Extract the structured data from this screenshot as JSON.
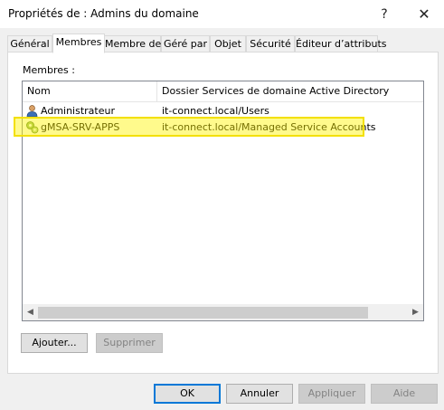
{
  "window": {
    "title": "Propriétés de : Admins du domaine",
    "help_icon": "?",
    "close_icon": "✕"
  },
  "tabs": [
    {
      "label": "Général"
    },
    {
      "label": "Membres"
    },
    {
      "label": "Membre de"
    },
    {
      "label": "Géré par"
    },
    {
      "label": "Objet"
    },
    {
      "label": "Sécurité"
    },
    {
      "label": "Éditeur d’attributs"
    }
  ],
  "active_tab": "Membres",
  "members": {
    "label": "Membres :",
    "columns": [
      "Nom",
      "Dossier Services de domaine Active Directory"
    ],
    "rows": [
      {
        "name": "Administrateur",
        "path": "it-connect.local/Users",
        "icon": "user-icon"
      },
      {
        "name": "gMSA-SRV-APPS",
        "path": "it-connect.local/Managed Service Accounts",
        "icon": "service-account-icon",
        "highlighted": true
      }
    ],
    "highlight_color": "#f3e000"
  },
  "buttons": {
    "add": "Ajouter...",
    "remove": "Supprimer",
    "ok": "OK",
    "cancel": "Annuler",
    "apply": "Appliquer",
    "help": "Aide"
  },
  "scroll": {
    "left_icon": "◀",
    "right_icon": "▶"
  }
}
